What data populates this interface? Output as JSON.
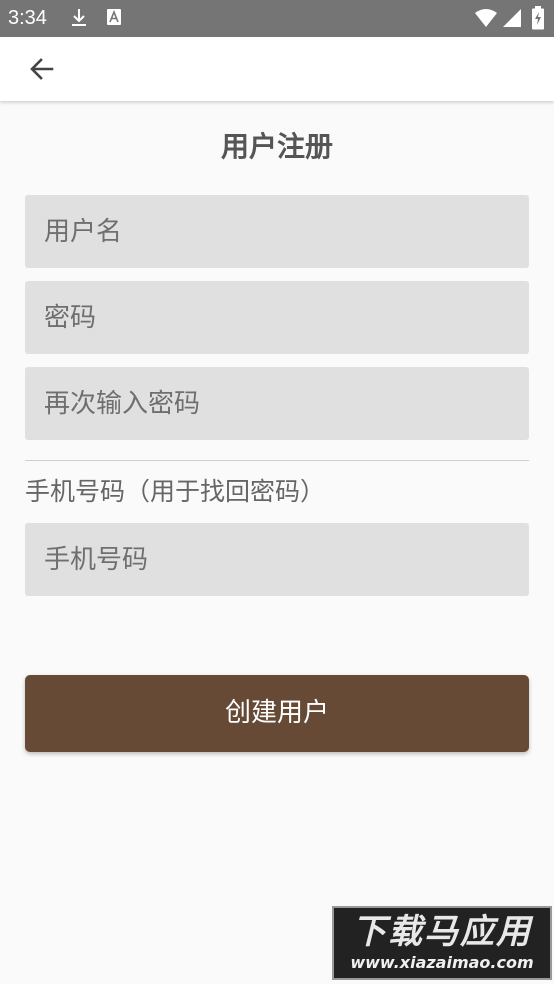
{
  "status_bar": {
    "time": "3:34",
    "icons": [
      "download-icon",
      "font-a-icon",
      "wifi-icon",
      "cellular-signal-icon",
      "battery-charging-icon"
    ]
  },
  "app_bar": {
    "back_icon": "arrow-left-icon"
  },
  "page": {
    "title": "用户注册"
  },
  "form": {
    "username_placeholder": "用户名",
    "password_placeholder": "密码",
    "password_confirm_placeholder": "再次输入密码",
    "phone_hint": "手机号码（用于找回密码）",
    "phone_placeholder": "手机号码",
    "create_button_label": "创建用户"
  },
  "colors": {
    "status_bar": "#757575",
    "background": "#fafafa",
    "field_background": "#e0e0e0",
    "button_brown": "#664a35"
  },
  "watermark": {
    "title": "下载马应用",
    "url": "www.xiazaimao.com"
  }
}
